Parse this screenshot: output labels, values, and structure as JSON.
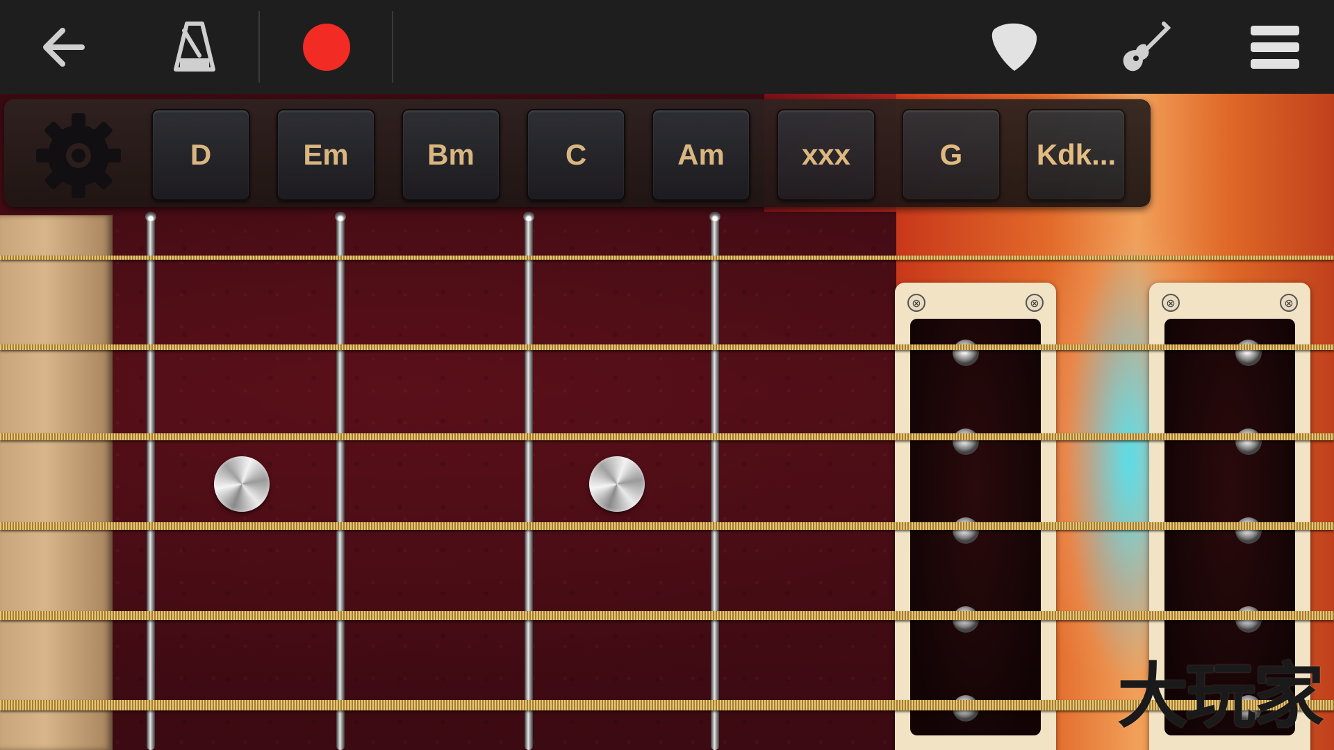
{
  "toolbar": {
    "back_icon": "back-arrow-icon",
    "metronome_icon": "metronome-icon",
    "record_icon": "record-icon",
    "record_color": "#f22b25",
    "pick_icon": "guitar-pick-icon",
    "guitar_icon": "guitar-icon",
    "menu_icon": "hamburger-menu-icon"
  },
  "chordbar": {
    "settings_icon": "gear-icon",
    "chords": [
      "D",
      "Em",
      "Bm",
      "C",
      "Am",
      "xxx",
      "G",
      "Kdk..."
    ],
    "label_color": "#e3c187"
  },
  "fretboard": {
    "frets": 4,
    "strings": 6,
    "inlays": 2,
    "pickups": 2,
    "pickup_close_icon": "close-icon",
    "close_glyph": "⊗"
  },
  "watermark": "大玩家"
}
